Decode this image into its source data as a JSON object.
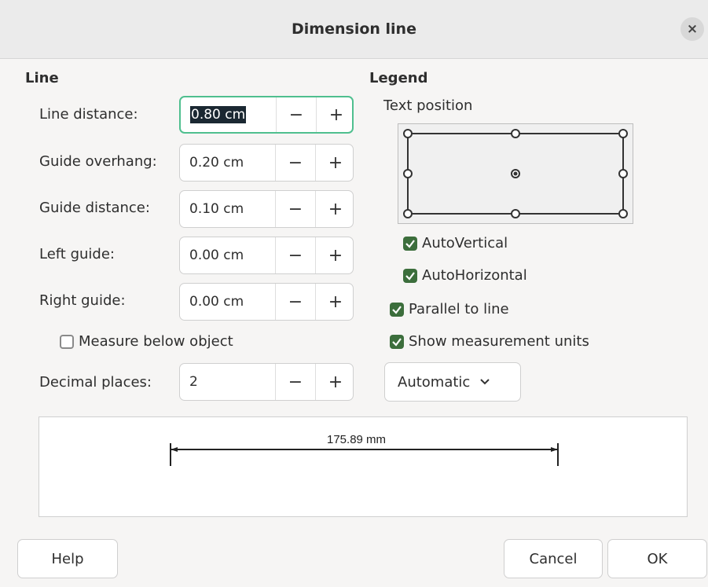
{
  "dialog": {
    "title": "Dimension line",
    "close_glyph": "×"
  },
  "line": {
    "heading": "Line",
    "line_distance": {
      "label": "Line distance:",
      "value": "0.80 cm"
    },
    "guide_overhang": {
      "label": "Guide overhang:",
      "value": "0.20 cm"
    },
    "guide_distance": {
      "label": "Guide distance:",
      "value": "0.10 cm"
    },
    "left_guide": {
      "label": "Left guide:",
      "value": "0.00 cm"
    },
    "right_guide": {
      "label": "Right guide:",
      "value": "0.00 cm"
    },
    "measure_below": {
      "label": "Measure below object",
      "checked": false
    },
    "decimal_places": {
      "label": "Decimal places:",
      "value": "2"
    },
    "minus_glyph": "−",
    "plus_glyph": "+"
  },
  "legend": {
    "heading": "Legend",
    "text_position_label": "Text position",
    "auto_vertical": {
      "label": "AutoVertical",
      "checked": true
    },
    "auto_horizontal": {
      "label": "AutoHorizontal",
      "checked": true
    },
    "parallel_to_line": {
      "label": "Parallel to line",
      "checked": true
    },
    "show_units": {
      "label": "Show measurement units",
      "checked": true
    },
    "units_dropdown": {
      "value": "Automatic"
    }
  },
  "preview": {
    "measurement": "175.89 mm"
  },
  "buttons": {
    "help": "Help",
    "cancel": "Cancel",
    "ok": "OK"
  },
  "colors": {
    "checkbox": "#3c6e3c",
    "focus_border": "#4fbf8f",
    "selection": "#1b2832"
  }
}
